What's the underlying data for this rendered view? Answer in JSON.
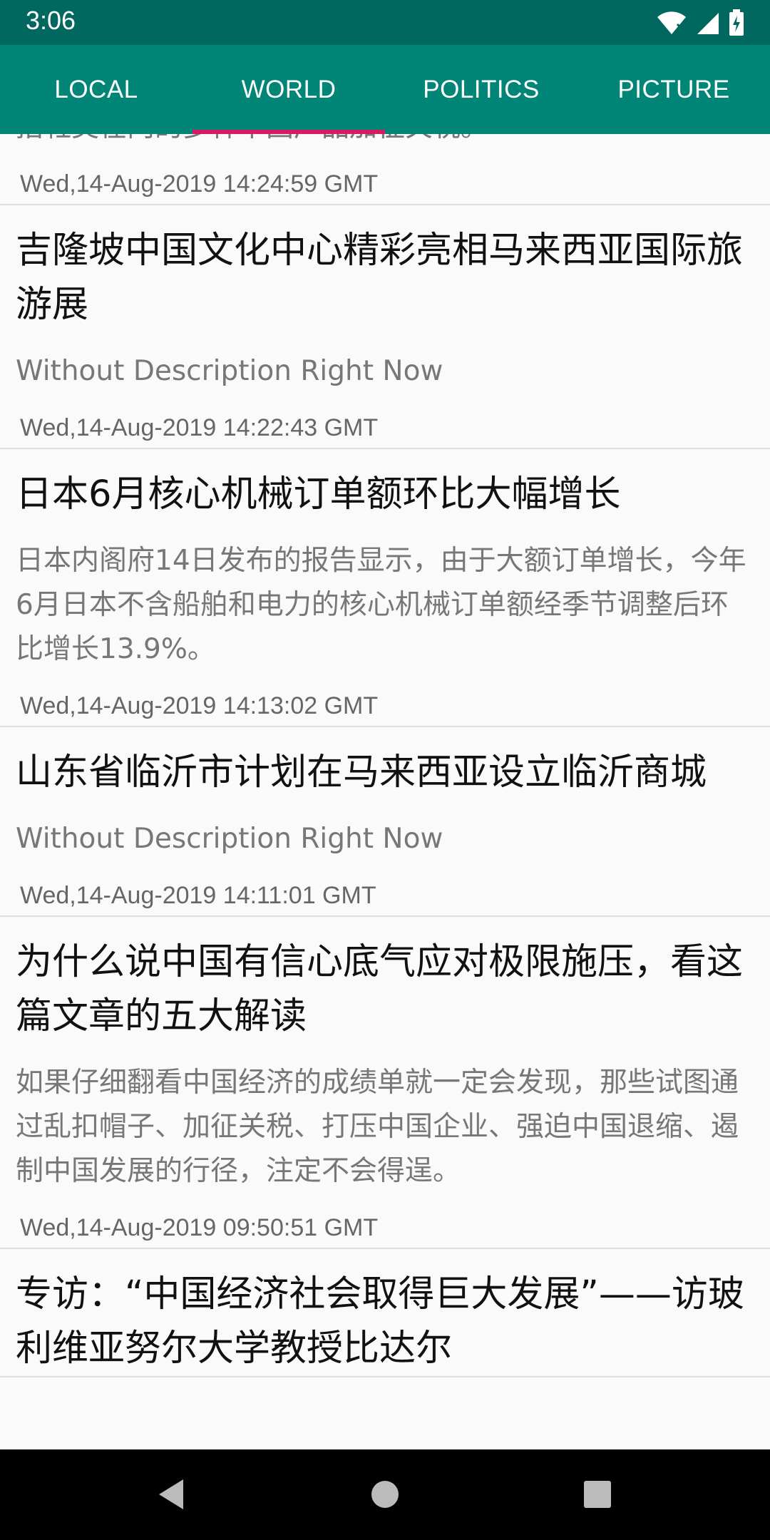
{
  "status_bar": {
    "time": "3:06",
    "icons": [
      "wifi-icon",
      "signal-icon",
      "battery-icon"
    ]
  },
  "tabs": [
    {
      "label": "LOCAL",
      "selected": false
    },
    {
      "label": "WORLD",
      "selected": true
    },
    {
      "label": "POLITICS",
      "selected": false
    },
    {
      "label": "PICTURE",
      "selected": false
    }
  ],
  "news": [
    {
      "title": "",
      "description": "括鞋类在内的多种中国产品加征关税。",
      "time": "Wed,14-Aug-2019 14:24:59 GMT"
    },
    {
      "title": "吉隆坡中国文化中心精彩亮相马来西亚国际旅游展",
      "description": "Without Description Right Now",
      "time": "Wed,14-Aug-2019 14:22:43 GMT"
    },
    {
      "title": "日本6月核心机械订单额环比大幅增长",
      "description": "日本内阁府14日发布的报告显示，由于大额订单增长，今年6月日本不含船舶和电力的核心机械订单额经季节调整后环比增长13.9%。",
      "time": "Wed,14-Aug-2019 14:13:02 GMT"
    },
    {
      "title": "山东省临沂市计划在马来西亚设立临沂商城",
      "description": "Without Description Right Now",
      "time": "Wed,14-Aug-2019 14:11:01 GMT"
    },
    {
      "title": "为什么说中国有信心底气应对极限施压，看这篇文章的五大解读",
      "description": "如果仔细翻看中国经济的成绩单就一定会发现，那些试图通过乱扣帽子、加征关税、打压中国企业、强迫中国退缩、遏制中国发展的行径，注定不会得逞。",
      "time": "Wed,14-Aug-2019 09:50:51 GMT"
    },
    {
      "title": "专访：“中国经济社会取得巨大发展”——访玻利维亚努尔大学教授比达尔",
      "description": "",
      "time": ""
    }
  ],
  "colors": {
    "status_bar": "#00685e",
    "tab_bar": "#008577",
    "tab_indicator": "#d81b60",
    "background": "#fafafa"
  },
  "nav": {
    "icons": [
      "back-icon",
      "home-icon",
      "recents-icon"
    ]
  }
}
